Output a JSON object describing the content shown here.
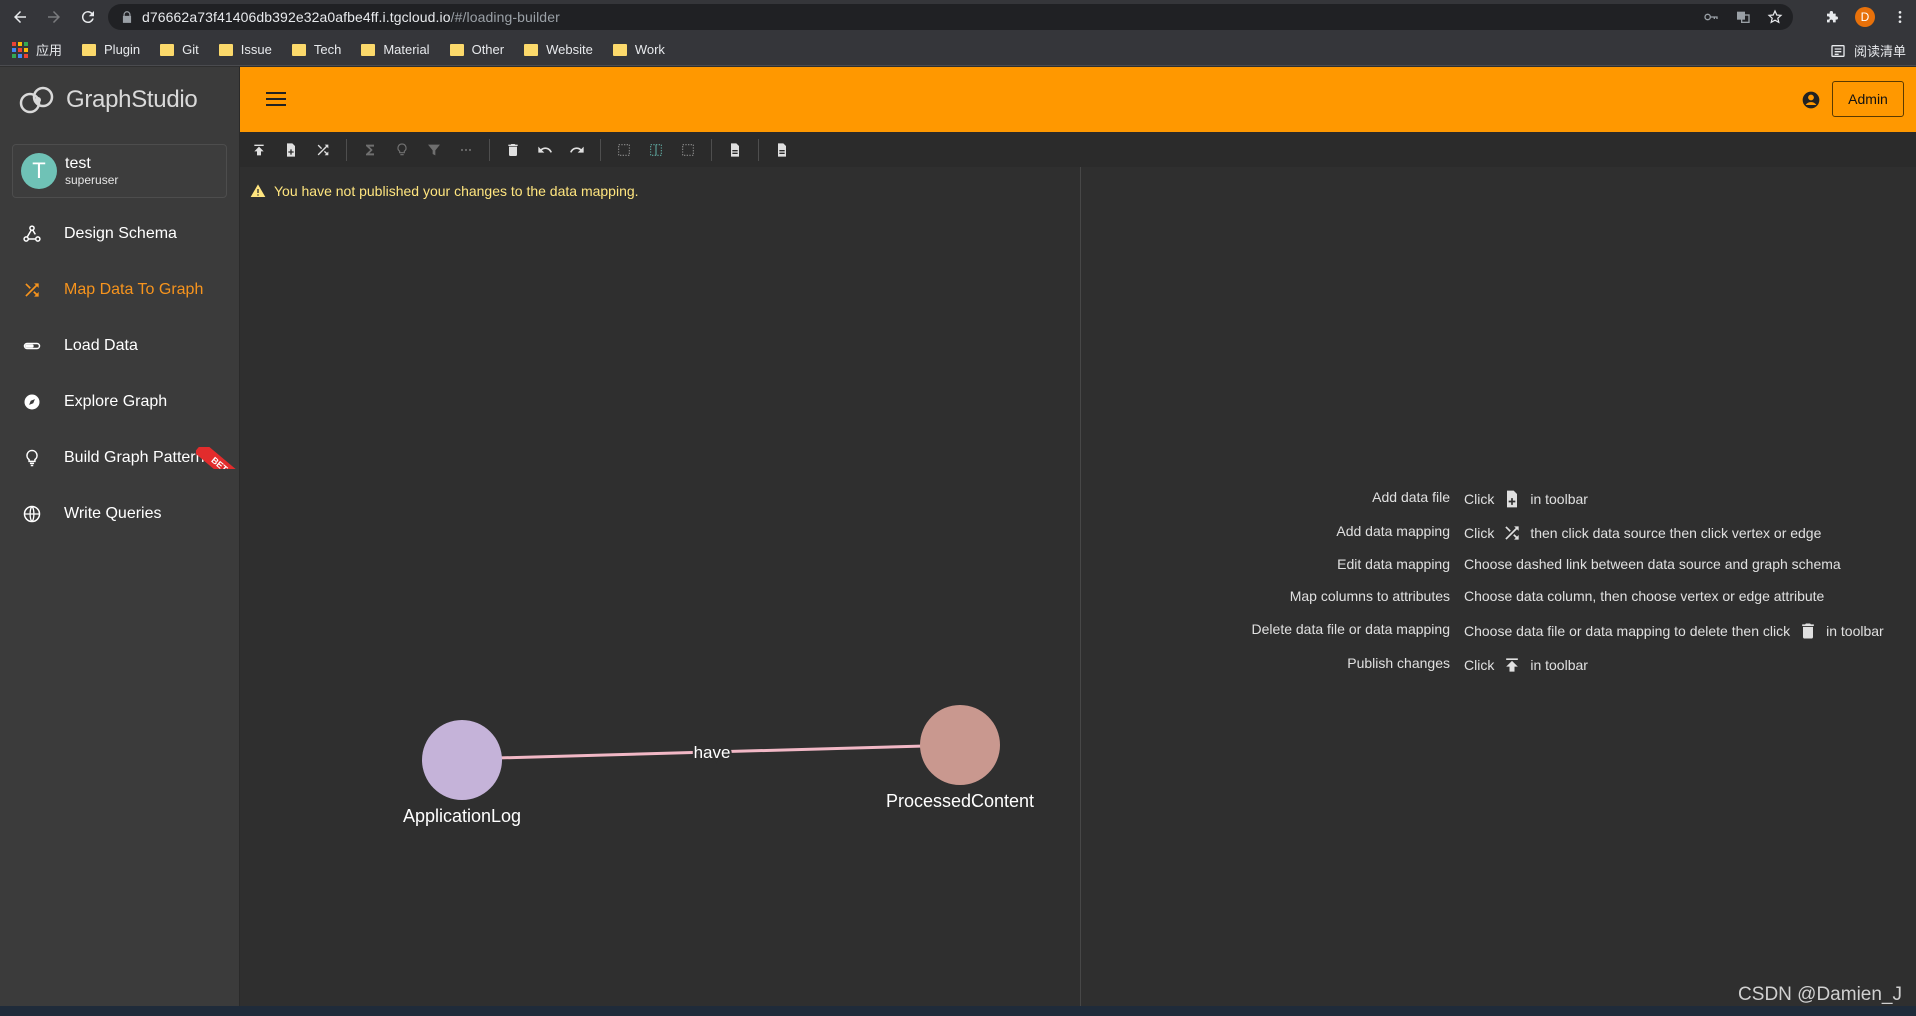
{
  "browser": {
    "url_main": "d76662a73f41406db392e32a0afbe4ff.i.tgcloud.io",
    "url_path": "/#/loading-builder",
    "profile_initial": "D",
    "bookmarks": [
      {
        "label": "应用",
        "icon": "apps-icon"
      },
      {
        "label": "Plugin",
        "icon": "folder-icon"
      },
      {
        "label": "Git",
        "icon": "folder-icon"
      },
      {
        "label": "Issue",
        "icon": "folder-icon"
      },
      {
        "label": "Tech",
        "icon": "folder-icon"
      },
      {
        "label": "Material",
        "icon": "folder-icon"
      },
      {
        "label": "Other",
        "icon": "folder-icon"
      },
      {
        "label": "Website",
        "icon": "folder-icon"
      },
      {
        "label": "Work",
        "icon": "folder-icon"
      }
    ],
    "reading_list": "阅读清单"
  },
  "app": {
    "logo_text": "GraphStudio",
    "user": {
      "initial": "T",
      "name": "test",
      "role": "superuser"
    },
    "menu": [
      {
        "label": "Design Schema",
        "icon": "schema-icon",
        "active": false
      },
      {
        "label": "Map Data To Graph",
        "icon": "shuffle-icon",
        "active": true
      },
      {
        "label": "Load Data",
        "icon": "load-icon",
        "active": false
      },
      {
        "label": "Explore Graph",
        "icon": "compass-icon",
        "active": false
      },
      {
        "label": "Build Graph Patterns",
        "icon": "bulb-icon",
        "active": false,
        "badge": "BETA"
      },
      {
        "label": "Write Queries",
        "icon": "globe-icon",
        "active": false
      }
    ],
    "admin_label": "Admin",
    "accent": "#ff9800",
    "active_color": "#f7941d"
  },
  "warning": "You have not published your changes to the data mapping.",
  "graph": {
    "vertices": [
      {
        "id": "ApplicationLog",
        "label": "ApplicationLog",
        "color": "#c5b3d9"
      },
      {
        "id": "ProcessedContent",
        "label": "ProcessedContent",
        "color": "#c9988f"
      }
    ],
    "edges": [
      {
        "from": "ApplicationLog",
        "to": "ProcessedContent",
        "label": "have",
        "color": "#f2b8c6"
      }
    ]
  },
  "help": [
    {
      "label": "Add data file",
      "pre": "Click",
      "icon": "add-file-icon",
      "post": "in toolbar"
    },
    {
      "label": "Add data mapping",
      "pre": "Click",
      "icon": "shuffle-icon",
      "post": "then click data source then click vertex or edge"
    },
    {
      "label": "Edit data mapping",
      "pre": "Choose dashed link between data source and graph schema",
      "icon": "",
      "post": ""
    },
    {
      "label": "Map columns to attributes",
      "pre": "Choose data column, then choose vertex or edge attribute",
      "icon": "",
      "post": ""
    },
    {
      "label": "Delete data file or data mapping",
      "pre": "Choose data file or data mapping to delete then click",
      "icon": "trash-icon",
      "post": "in toolbar"
    },
    {
      "label": "Publish changes",
      "pre": "Click",
      "icon": "publish-icon",
      "post": "in toolbar"
    }
  ],
  "watermark": "CSDN @Damien_J"
}
